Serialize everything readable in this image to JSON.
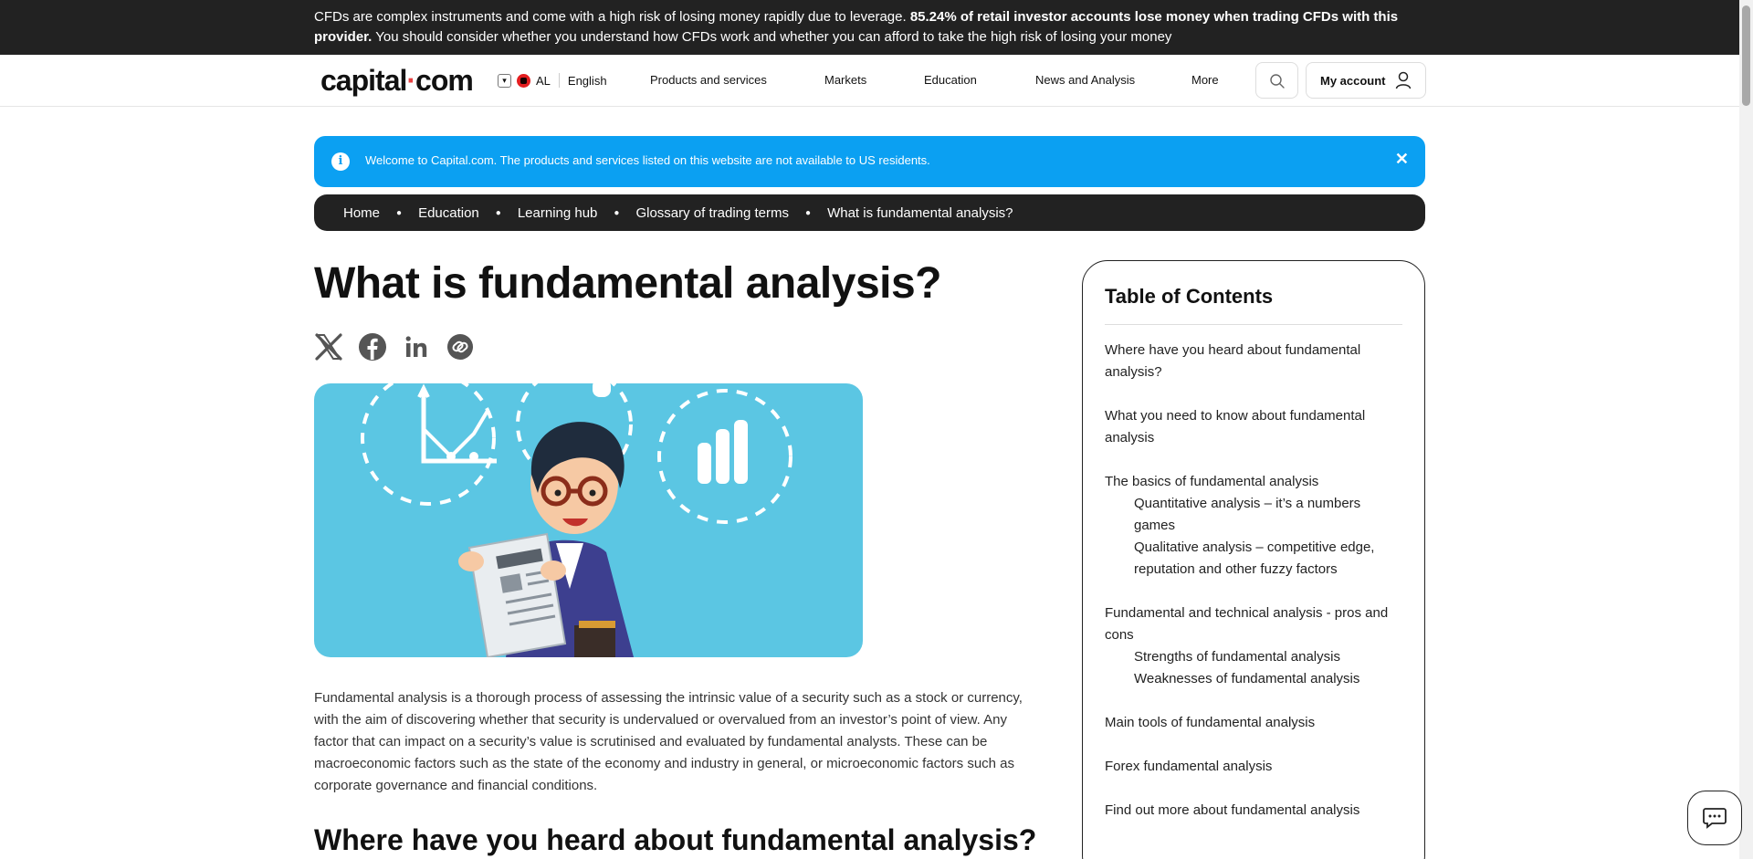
{
  "risk_banner": {
    "part1": "CFDs are complex instruments and come with a high risk of losing money rapidly due to leverage. ",
    "bold": "85.24% of retail investor accounts lose money when trading CFDs with this provider.",
    "part2": " You should consider whether you understand how CFDs work and whether you can afford to take the high risk of losing your money"
  },
  "nav": {
    "logo_left": "capital",
    "logo_dot": "·",
    "logo_right": "com",
    "country_code": "AL",
    "language": "English",
    "menu": [
      "Products and services",
      "Markets",
      "Education",
      "News and Analysis",
      "More"
    ],
    "account_label": "My account"
  },
  "info_banner": {
    "text": "Welcome to Capital.com. The products and services listed on this website are not available to US residents.",
    "close": "✕"
  },
  "breadcrumb": [
    "Home",
    "Education",
    "Learning hub",
    "Glossary of trading terms",
    "What is fundamental analysis?"
  ],
  "article": {
    "title": "What is fundamental analysis?",
    "share_icons": [
      "x-icon",
      "facebook-icon",
      "linkedin-icon",
      "copy-link-icon"
    ],
    "intro": "Fundamental analysis is a thorough process of assessing the intrinsic value of a security such as a stock or currency, with the aim of discovering whether that security is undervalued or overvalued from an investor’s point of view. Any factor that can impact on a security’s value is scrutinised and evaluated by fundamental analysts. These can be macroeconomic factors such as the state of the economy and industry in general, or microeconomic factors such as corporate governance and financial conditions.",
    "section_heading": "Where have you heard about fundamental analysis?"
  },
  "toc": {
    "title": "Table of Contents",
    "items": [
      {
        "label": "Where have you heard about fundamental analysis?",
        "subs": []
      },
      {
        "label": "What you need to know about fundamental analysis",
        "subs": []
      },
      {
        "label": "The basics of fundamental analysis",
        "subs": [
          "Quantitative analysis – it’s a numbers games",
          "Qualitative analysis – competitive edge, reputation and other fuzzy factors"
        ]
      },
      {
        "label": "Fundamental and technical analysis - pros and cons",
        "subs": [
          "Strengths of fundamental analysis",
          "Weaknesses of fundamental analysis"
        ]
      },
      {
        "label": "Main tools of fundamental analysis",
        "subs": []
      },
      {
        "label": "Forex fundamental analysis",
        "subs": []
      },
      {
        "label": "Find out more about fundamental analysis",
        "subs": []
      }
    ]
  },
  "colors": {
    "banner_bg": "#222222",
    "info_blue": "#0ba0f2",
    "logo_dot": "#e84142",
    "hero_bg": "#5bc6e3"
  }
}
